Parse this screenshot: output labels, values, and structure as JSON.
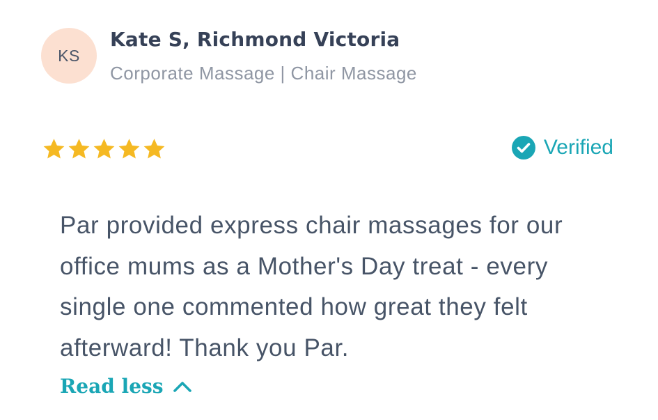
{
  "review": {
    "avatar_initials": "KS",
    "reviewer_name": "Kate S, Richmond Victoria",
    "service": "Corporate Massage | Chair Massage",
    "rating": 5,
    "rating_max": 5,
    "verified_label": "Verified",
    "text": "Par provided express chair massages for our office mums as a Mother's Day treat - every single one commented how great they felt afterward! Thank you Par.",
    "read_less_label": "Read less"
  },
  "icons": {
    "star": "star-icon",
    "verified": "check-circle-icon",
    "read_less": "chevron-up-icon"
  },
  "colors": {
    "star": "#f5b923",
    "accent": "#1aa6b5",
    "avatar_bg": "#fce0d1",
    "name": "#364157",
    "muted": "#8f96a3",
    "body_text": "#475467"
  }
}
